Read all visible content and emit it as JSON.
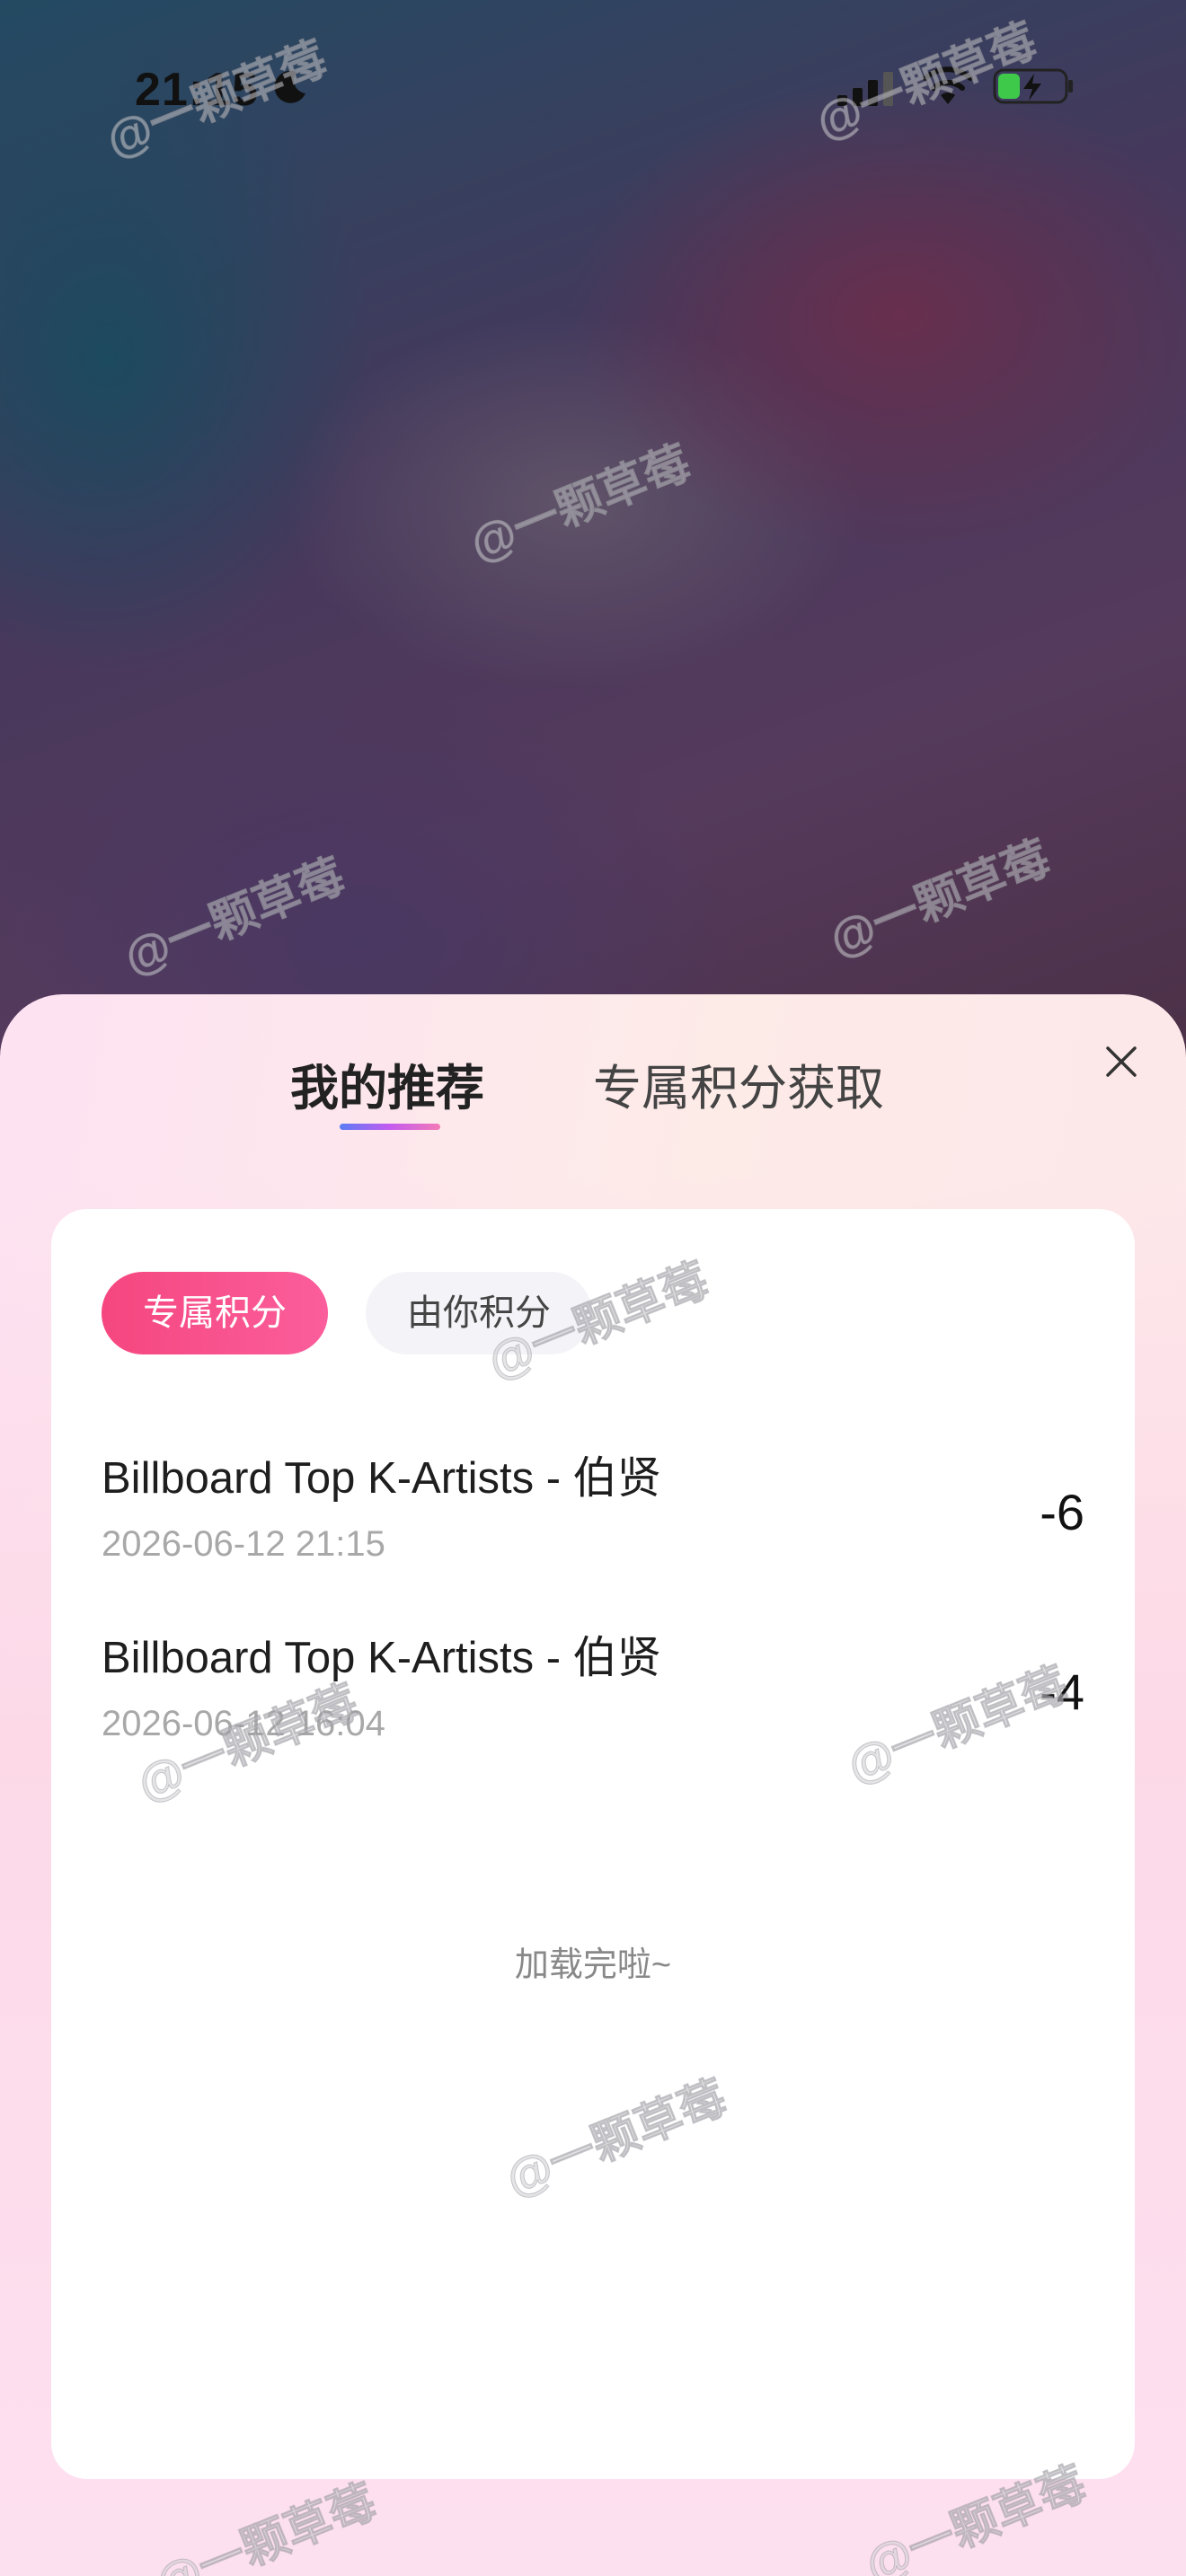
{
  "status_bar": {
    "time": "21:15",
    "battery_color": "#3ec94b"
  },
  "sheet": {
    "tabs": [
      {
        "label": "我的推荐",
        "active": true
      },
      {
        "label": "专属积分获取",
        "active": false
      }
    ],
    "filters": [
      {
        "label": "专属积分",
        "active": true
      },
      {
        "label": "由你积分",
        "active": false
      }
    ],
    "records": [
      {
        "title": "Billboard Top K-Artists - 伯贤",
        "date": "2026-06-12 21:15",
        "value": "-6"
      },
      {
        "title": "Billboard Top K-Artists - 伯贤",
        "date": "2026-06-12 16:04",
        "value": "-4"
      }
    ],
    "end_text": "加载完啦~"
  },
  "watermark": "@一颗草莓",
  "colors": {
    "accent": "#f5467f",
    "tab_underline": [
      "#5a7cf5",
      "#c45cf0",
      "#f37ab7"
    ]
  }
}
